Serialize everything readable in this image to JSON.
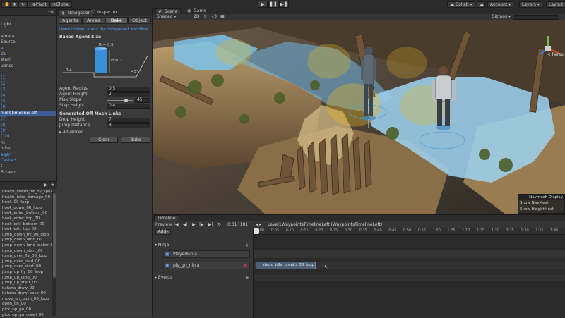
{
  "toolbar": {
    "pivot": "Pivot",
    "global": "Global",
    "collab": "Collab",
    "account": "Account",
    "layers": "Layers",
    "layout": "Layout"
  },
  "hierarchy": {
    "items": [
      {
        "label": "Light",
        "style": "normal"
      },
      {
        "label": "",
        "style": "normal"
      },
      {
        "label": "amera",
        "style": "normal"
      },
      {
        "label": "Source",
        "style": "normal"
      },
      {
        "label": "a",
        "style": "blue"
      },
      {
        "label": "ck",
        "style": "normal"
      },
      {
        "label": "stem",
        "style": "normal"
      },
      {
        "label": "uence",
        "style": "normal"
      },
      {
        "label": "",
        "style": "normal"
      },
      {
        "label": "(1)",
        "style": "blue"
      },
      {
        "label": "(2)",
        "style": "blue"
      },
      {
        "label": "(3)",
        "style": "blue"
      },
      {
        "label": "(4)",
        "style": "blue"
      },
      {
        "label": "(5)",
        "style": "blue"
      },
      {
        "label": "(6)",
        "style": "blue"
      },
      {
        "label": "ointsTimelineLeft",
        "style": "selected"
      },
      {
        "label": "(7)",
        "style": "blue"
      },
      {
        "label": "(8)",
        "style": "blue"
      },
      {
        "label": "(9)",
        "style": "blue"
      },
      {
        "label": "(10)",
        "style": "blue"
      },
      {
        "label": "m",
        "style": "normal"
      },
      {
        "label": "other",
        "style": "normal"
      },
      {
        "label": "ager",
        "style": "blue"
      },
      {
        "label": "Castle*",
        "style": "blue"
      },
      {
        "label": "t",
        "style": "normal"
      },
      {
        "label": "Screen",
        "style": "normal"
      }
    ]
  },
  "project": {
    "items": [
      "health_stand_hit_by_spear_",
      "health_take_damage_00",
      "hook_00_loop",
      "hook_down_00_loop",
      "hook_enter_bottom_00",
      "hook_enter_top_00",
      "hook_exit_bottom_00",
      "hook_exit_top_00",
      "jump_down_fly_00_loop",
      "jump_down_land_00",
      "jump_down_land_water_00",
      "jump_down_start_00",
      "jump_over_fly_00_loop",
      "jump_over_land_00",
      "jump_over_start_00",
      "jump_up_fly_00_loop",
      "jump_up_land_00",
      "jump_up_start_00",
      "katana_draw_00",
      "katana_draw_pose_00",
      "move_gn_push_00_loop",
      "open_gn_00",
      "pick_up_gn_00",
      "pick_up_gn_crawl_00"
    ]
  },
  "navigation": {
    "tab_navigation": "Navigation",
    "tab_inspector": "Inspector",
    "subtabs": [
      "Agents",
      "Areas",
      "Bake",
      "Object"
    ],
    "learn_link": "Learn instead about the component workflow.",
    "baked_agent_size": "Baked Agent Size",
    "diagram": {
      "r": "R = 0.5",
      "h": "H = 2",
      "left": "0.4",
      "angle": "45°"
    },
    "fields": [
      {
        "label": "Agent Radius",
        "value": "0.5"
      },
      {
        "label": "Agent Height",
        "value": "2"
      },
      {
        "label": "Max Slope",
        "value": "45"
      },
      {
        "label": "Step Height",
        "value": "0.4"
      }
    ],
    "offmesh_title": "Generated Off Mesh Links",
    "offmesh_fields": [
      {
        "label": "Drop Height",
        "value": "7"
      },
      {
        "label": "Jump Distance",
        "value": "8"
      }
    ],
    "advanced": "Advanced",
    "clear": "Clear",
    "bake": "Bake"
  },
  "scene_view": {
    "tab_scene": "Scene",
    "tab_game": "Game",
    "shaded": "Shaded",
    "mode_2d": "2D",
    "gizmos": "Gizmos",
    "persp": "< Persp",
    "navmesh_display": {
      "title": "Navmesh Display",
      "show_navmesh": "Show NavMesh",
      "show_heightmesh": "Show HeightMesh"
    }
  },
  "timeline": {
    "title": "Timeline",
    "preview": "Preview",
    "frame": "0:01 [181]",
    "add": "Add",
    "breadcrumb": "Level1WaypointsTimelineLeft (WaypointsTimelineLeft)",
    "ruler": [
      "0:00",
      "0:05",
      "0:10",
      "0:15",
      "0:20",
      "0:25",
      "0:30",
      "0:35",
      "0:40",
      "0:45",
      "0:50",
      "0:55",
      "1:00",
      "1:05",
      "1:10",
      "1:15",
      "1:20",
      "1:25",
      "1:30",
      "1:35",
      "1:40"
    ],
    "groups": [
      "Ninja",
      "Events"
    ],
    "tracks": [
      "PlayerNinja",
      "ply_gn_ninja"
    ],
    "clip": "_stand_idle_breath_00_loop"
  }
}
